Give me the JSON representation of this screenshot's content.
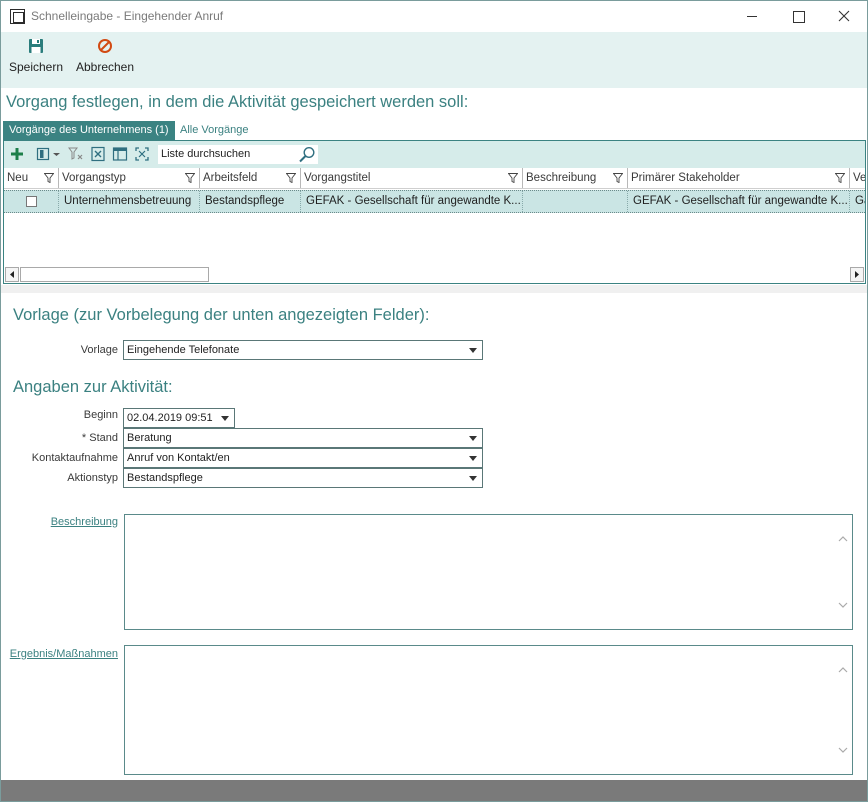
{
  "window": {
    "title": "Schnelleingabe - Eingehender Anruf"
  },
  "toolbar": {
    "save_label": "Speichern",
    "cancel_label": "Abbrechen"
  },
  "heading_process": "Vorgang festlegen, in dem die Aktivität gespeichert werden soll:",
  "tabs": [
    {
      "label": "Vorgänge des Unternehmens (1)",
      "active": true
    },
    {
      "label": "Alle Vorgänge",
      "active": false
    }
  ],
  "grid": {
    "search_placeholder": "Liste durchsuchen",
    "columns": [
      "Neu",
      "Vorgangstyp",
      "Arbeitsfeld",
      "Vorgangstitel",
      "Beschreibung",
      "Primärer Stakeholder",
      "Ve"
    ],
    "rows": [
      {
        "neu": false,
        "vorgangstyp": "Unternehmensbetreuung",
        "arbeitsfeld": "Bestandspflege",
        "vorgangstitel": "GEFAK - Gesellschaft für angewandte K...",
        "beschreibung": "",
        "stakeholder": "GEFAK - Gesellschaft für angewandte K...",
        "ve": "Ga"
      }
    ]
  },
  "template_section": {
    "heading": "Vorlage (zur Vorbelegung der unten angezeigten Felder):",
    "label": "Vorlage",
    "value": "Eingehende Telefonate"
  },
  "activity_section": {
    "heading": "Angaben zur Aktivität:",
    "fields": {
      "beginn": {
        "label": "Beginn",
        "value": "02.04.2019 09:51"
      },
      "stand": {
        "label": "* Stand",
        "value": "Beratung"
      },
      "kontakt": {
        "label": "Kontaktaufnahme",
        "value": "Anruf von Kontakt/en"
      },
      "aktionstyp": {
        "label": "Aktionstyp",
        "value": "Bestandspflege"
      }
    },
    "beschreibung_label": "Beschreibung",
    "ergebnis_label": "Ergebnis/Maßnahmen"
  },
  "colors": {
    "accent": "#3b8382",
    "toolbar_bg": "#e4f2f1",
    "selected_row": "#cae5e4",
    "heading": "#3b8181",
    "save_icon": "#2a7d7c",
    "cancel_icon": "#d24a12"
  },
  "icons": [
    "app-window-icon",
    "save-icon",
    "cancel-icon",
    "add-icon",
    "columns-icon",
    "clear-filter-icon",
    "excel-export-icon",
    "layout-icon",
    "fit-icon",
    "search-icon",
    "filter-icon"
  ]
}
